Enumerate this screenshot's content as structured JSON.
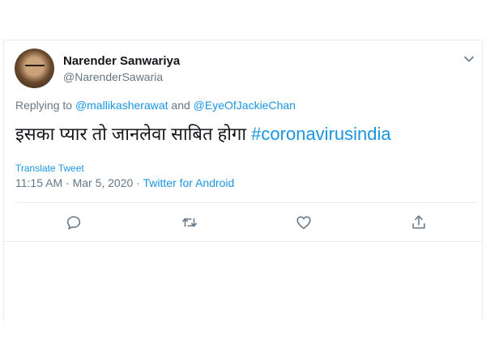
{
  "tweet": {
    "author_name": "Narender Sanwariya",
    "author_handle": "@NarenderSawaria",
    "replying_prefix": "Replying to ",
    "reply_to_1": "@mallikasherawat",
    "reply_joiner": " and ",
    "reply_to_2": "@EyeOfJackieChan",
    "text": "इसका प्यार तो जानलेवा साबित होगा ",
    "hashtag": "#coronavirusindia",
    "translate_label": "Translate Tweet",
    "time": "11:15 AM",
    "date": "Mar 5, 2020",
    "separator": " · ",
    "source": "Twitter for Android"
  },
  "icons": {
    "menu": "chevron-down-icon",
    "reply": "reply-icon",
    "retweet": "retweet-icon",
    "like": "heart-icon",
    "share": "share-icon"
  },
  "colors": {
    "link": "#1b95e0",
    "muted": "#657786",
    "text": "#14171a",
    "border": "#e6ecf0"
  }
}
